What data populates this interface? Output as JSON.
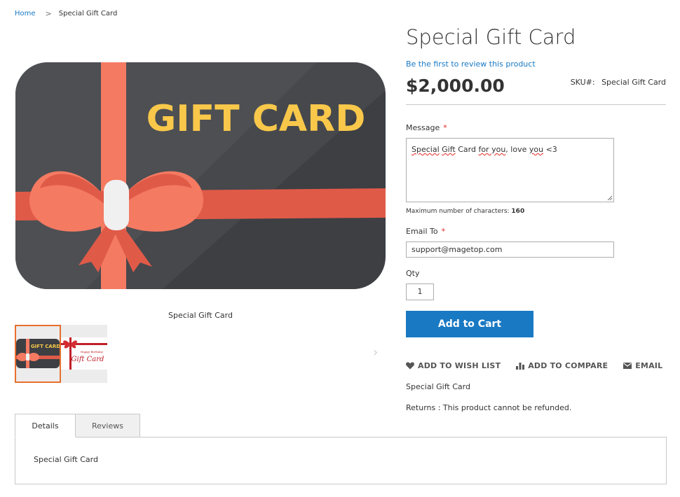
{
  "breadcrumb": {
    "home": "Home",
    "separator": ">",
    "current": "Special Gift Card"
  },
  "gallery": {
    "image_text": "GIFT CARD",
    "caption": "Special Gift Card",
    "thumb_small_text": "GIFT CARD",
    "thumb2_text": "Gift Card",
    "thumb2_small_text": "Happy Birthday",
    "next_arrow": "›"
  },
  "product": {
    "title": "Special Gift Card",
    "review_link": "Be the first to review this product",
    "price": "$2,000.00",
    "sku_label": "SKU#:",
    "sku_value": "Special Gift Card"
  },
  "form": {
    "message_label": "Message",
    "required_mark": "*",
    "message_parts": [
      "Special",
      " ",
      "Gift",
      " Card ",
      "for you",
      ", love ",
      "you",
      " <3"
    ],
    "max_chars_label": "Maximum number of characters:",
    "max_chars_value": "160",
    "email_label": "Email To",
    "email_value": "support@magetop.com",
    "qty_label": "Qty",
    "qty_value": "1",
    "add_to_cart": "Add to Cart"
  },
  "actions": {
    "wishlist": "ADD TO WISH LIST",
    "compare": "ADD TO COMPARE",
    "email": "EMAIL"
  },
  "info": {
    "short_description": "Special Gift Card",
    "returns": "Returns : This product cannot be refunded."
  },
  "tabs": {
    "details": "Details",
    "reviews": "Reviews",
    "details_content": "Special Gift Card"
  },
  "colors": {
    "link": "#1979c3",
    "button": "#1979c3",
    "card_dark": "#3d3f43",
    "ribbon": "#f47a62",
    "gift_text": "#f9c84a",
    "thumb_active_border": "#e86f2c"
  }
}
